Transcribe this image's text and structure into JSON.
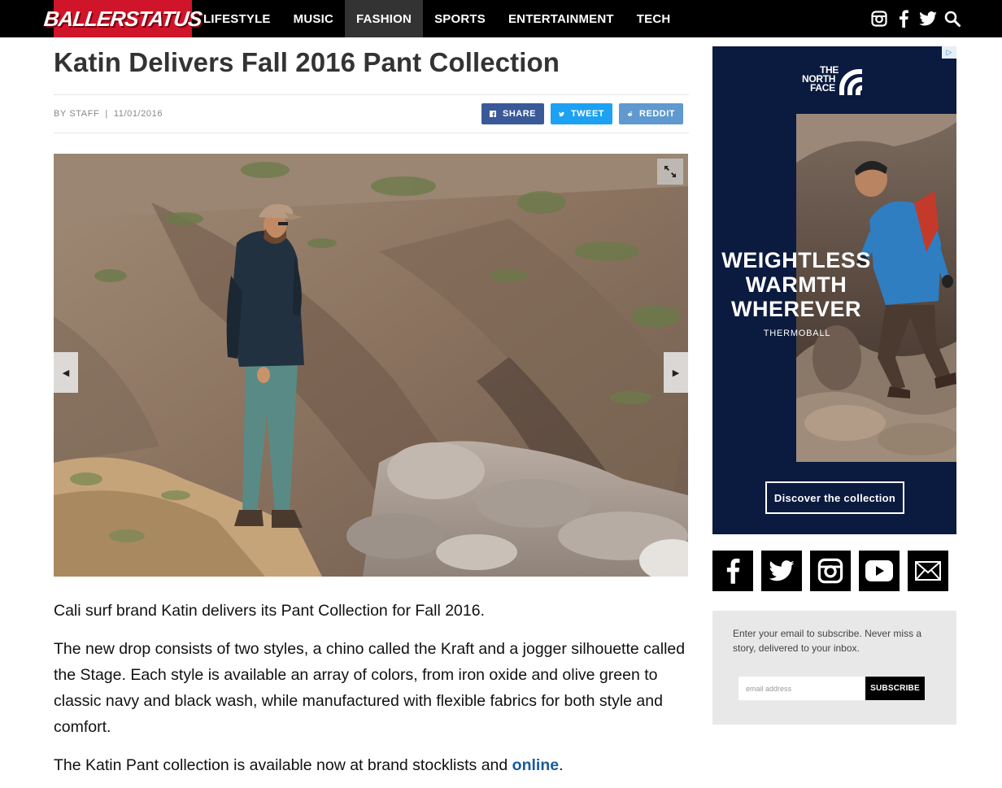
{
  "header": {
    "logo_text": "BALLERSTATUS",
    "nav": [
      {
        "label": "LIFESTYLE"
      },
      {
        "label": "MUSIC"
      },
      {
        "label": "FASHION",
        "active": true
      },
      {
        "label": "SPORTS"
      },
      {
        "label": "ENTERTAINMENT"
      },
      {
        "label": "TECH"
      }
    ],
    "social_icons": [
      "instagram-icon",
      "facebook-icon",
      "twitter-icon",
      "search-icon"
    ]
  },
  "article": {
    "title": "Katin Delivers Fall 2016 Pant Collection",
    "author": "BY STAFF",
    "separator": "|",
    "date": "11/01/2016",
    "share": {
      "facebook_label": "SHARE",
      "twitter_label": "TWEET",
      "reddit_label": "REDDIT"
    },
    "paragraphs": {
      "p1": "Cali surf brand Katin delivers its Pant Collection for Fall 2016.",
      "p2": "The new drop consists of two styles, a chino called the Kraft and a jogger silhouette called the Stage. Each style is available an array of colors, from iron oxide and olive green to classic navy and black wash, while manufactured with flexible fabrics for both style and comfort.",
      "p3_before": "The Katin Pant collection is available now at brand stocklists and ",
      "p3_link": "online",
      "p3_after": "."
    }
  },
  "ad": {
    "brand_line1": "THE",
    "brand_line2": "NORTH",
    "brand_line3": "FACE",
    "headline_line1": "WEIGHTLESS",
    "headline_line2": "WARMTH",
    "headline_line3": "WHEREVER",
    "sub_brand": "THERMOBALL",
    "cta": "Discover the collection",
    "colors": {
      "background": "#0b1a3f"
    }
  },
  "sidebar_social": [
    "facebook-icon",
    "twitter-icon",
    "instagram-icon",
    "youtube-icon",
    "mail-icon"
  ],
  "subscribe": {
    "text": "Enter your email to subscribe. Never miss a story, delivered to your inbox.",
    "placeholder": "email address",
    "button": "SUBSCRIBE"
  },
  "colors": {
    "logo_bg": "#d0152a",
    "nav_bg": "#000000",
    "link": "#1a5a9c"
  }
}
